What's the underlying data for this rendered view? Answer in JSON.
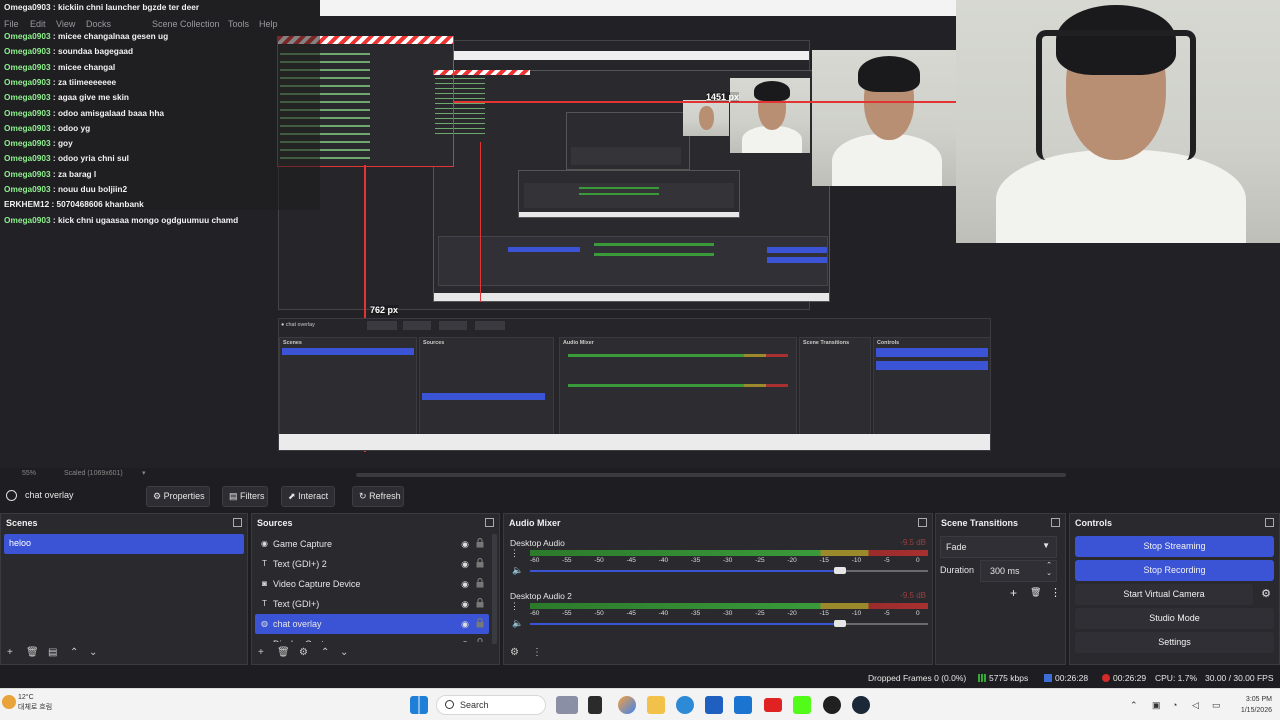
{
  "menu": [
    "File",
    "Edit",
    "View",
    "Docks",
    "Scene Collection",
    "Tools",
    "Help"
  ],
  "chat": {
    "first_line": "Omega0903 : kickiin chni launcher bgzde ter deer",
    "lines": [
      {
        "user": "Omega0903",
        "text": " : micee changalnaa gesen ug"
      },
      {
        "user": "Omega0903",
        "text": " : soundaa bagegaad"
      },
      {
        "user": "Omega0903",
        "text": " : micee changal"
      },
      {
        "user": "Omega0903",
        "text": " : za tiimeeeeeee"
      },
      {
        "user": "Omega0903",
        "text": " : agaa give me skin"
      },
      {
        "user": "Omega0903",
        "text": " : odoo amisgalaad baaa hha"
      },
      {
        "user": "Omega0903",
        "text": " : odoo yg"
      },
      {
        "user": "Omega0903",
        "text": " : goy"
      },
      {
        "user": "Omega0903",
        "text": " : odoo yria chni sul"
      },
      {
        "user": "Omega0903",
        "text": " : za barag l"
      },
      {
        "user": "Omega0903",
        "text": " : nouu duu boljiin2"
      },
      {
        "user": "ERKHEM12",
        "text": " : 5070468606 khanbank"
      },
      {
        "user": "Omega0903",
        "text": " : kick chni ugaasaa mongo ogdguumuu chamd"
      }
    ]
  },
  "preview": {
    "width_label": "1451 px",
    "height_label": "762 px",
    "zoom": "55%",
    "scaled": "Scaled (1069x601)"
  },
  "context": {
    "source_name": "chat overlay",
    "properties": "Properties",
    "filters": "Filters",
    "interact": "Interact",
    "refresh": "Refresh"
  },
  "scenes": {
    "title": "Scenes",
    "items": [
      "heloo"
    ]
  },
  "sources": {
    "title": "Sources",
    "items": [
      {
        "label": "Game Capture",
        "icon": "game-icon"
      },
      {
        "label": "Text (GDI+) 2",
        "icon": "text-icon"
      },
      {
        "label": "Video Capture Device",
        "icon": "camera-icon"
      },
      {
        "label": "Text (GDI+)",
        "icon": "text-icon"
      },
      {
        "label": "chat overlay",
        "icon": "browser-icon",
        "selected": true
      },
      {
        "label": "Display Capture",
        "icon": "display-icon"
      }
    ]
  },
  "mixer": {
    "title": "Audio Mixer",
    "channels": [
      {
        "name": "Desktop Audio",
        "db": "-9.5 dB",
        "volume": 0.78
      },
      {
        "name": "Desktop Audio 2",
        "db": "-9.5 dB",
        "volume": 0.78
      }
    ],
    "scale": [
      "-60",
      "-55",
      "-50",
      "-45",
      "-40",
      "-35",
      "-30",
      "-25",
      "-20",
      "-15",
      "-10",
      "-5",
      "0"
    ]
  },
  "transitions": {
    "title": "Scene Transitions",
    "selected": "Fade",
    "duration_label": "Duration",
    "duration": "300 ms"
  },
  "controls": {
    "title": "Controls",
    "stop_streaming": "Stop Streaming",
    "stop_recording": "Stop Recording",
    "virtual_camera": "Start Virtual Camera",
    "studio_mode": "Studio Mode",
    "settings": "Settings"
  },
  "status": {
    "dropped": "Dropped Frames 0 (0.0%)",
    "bitrate": "5775 kbps",
    "stream_time": "00:26:28",
    "rec_time": "00:26:29",
    "cpu": "CPU: 1.7%",
    "fps": "30.00 / 30.00 FPS"
  },
  "taskbar": {
    "temp": "12°C",
    "weather": "대체로 흐림",
    "search": "Search",
    "time": "3:05 PM",
    "date": "1/15/2026"
  },
  "colors": {
    "accent": "#3b54d6",
    "chat_user": "#8ef08e",
    "guide": "#e33333"
  }
}
